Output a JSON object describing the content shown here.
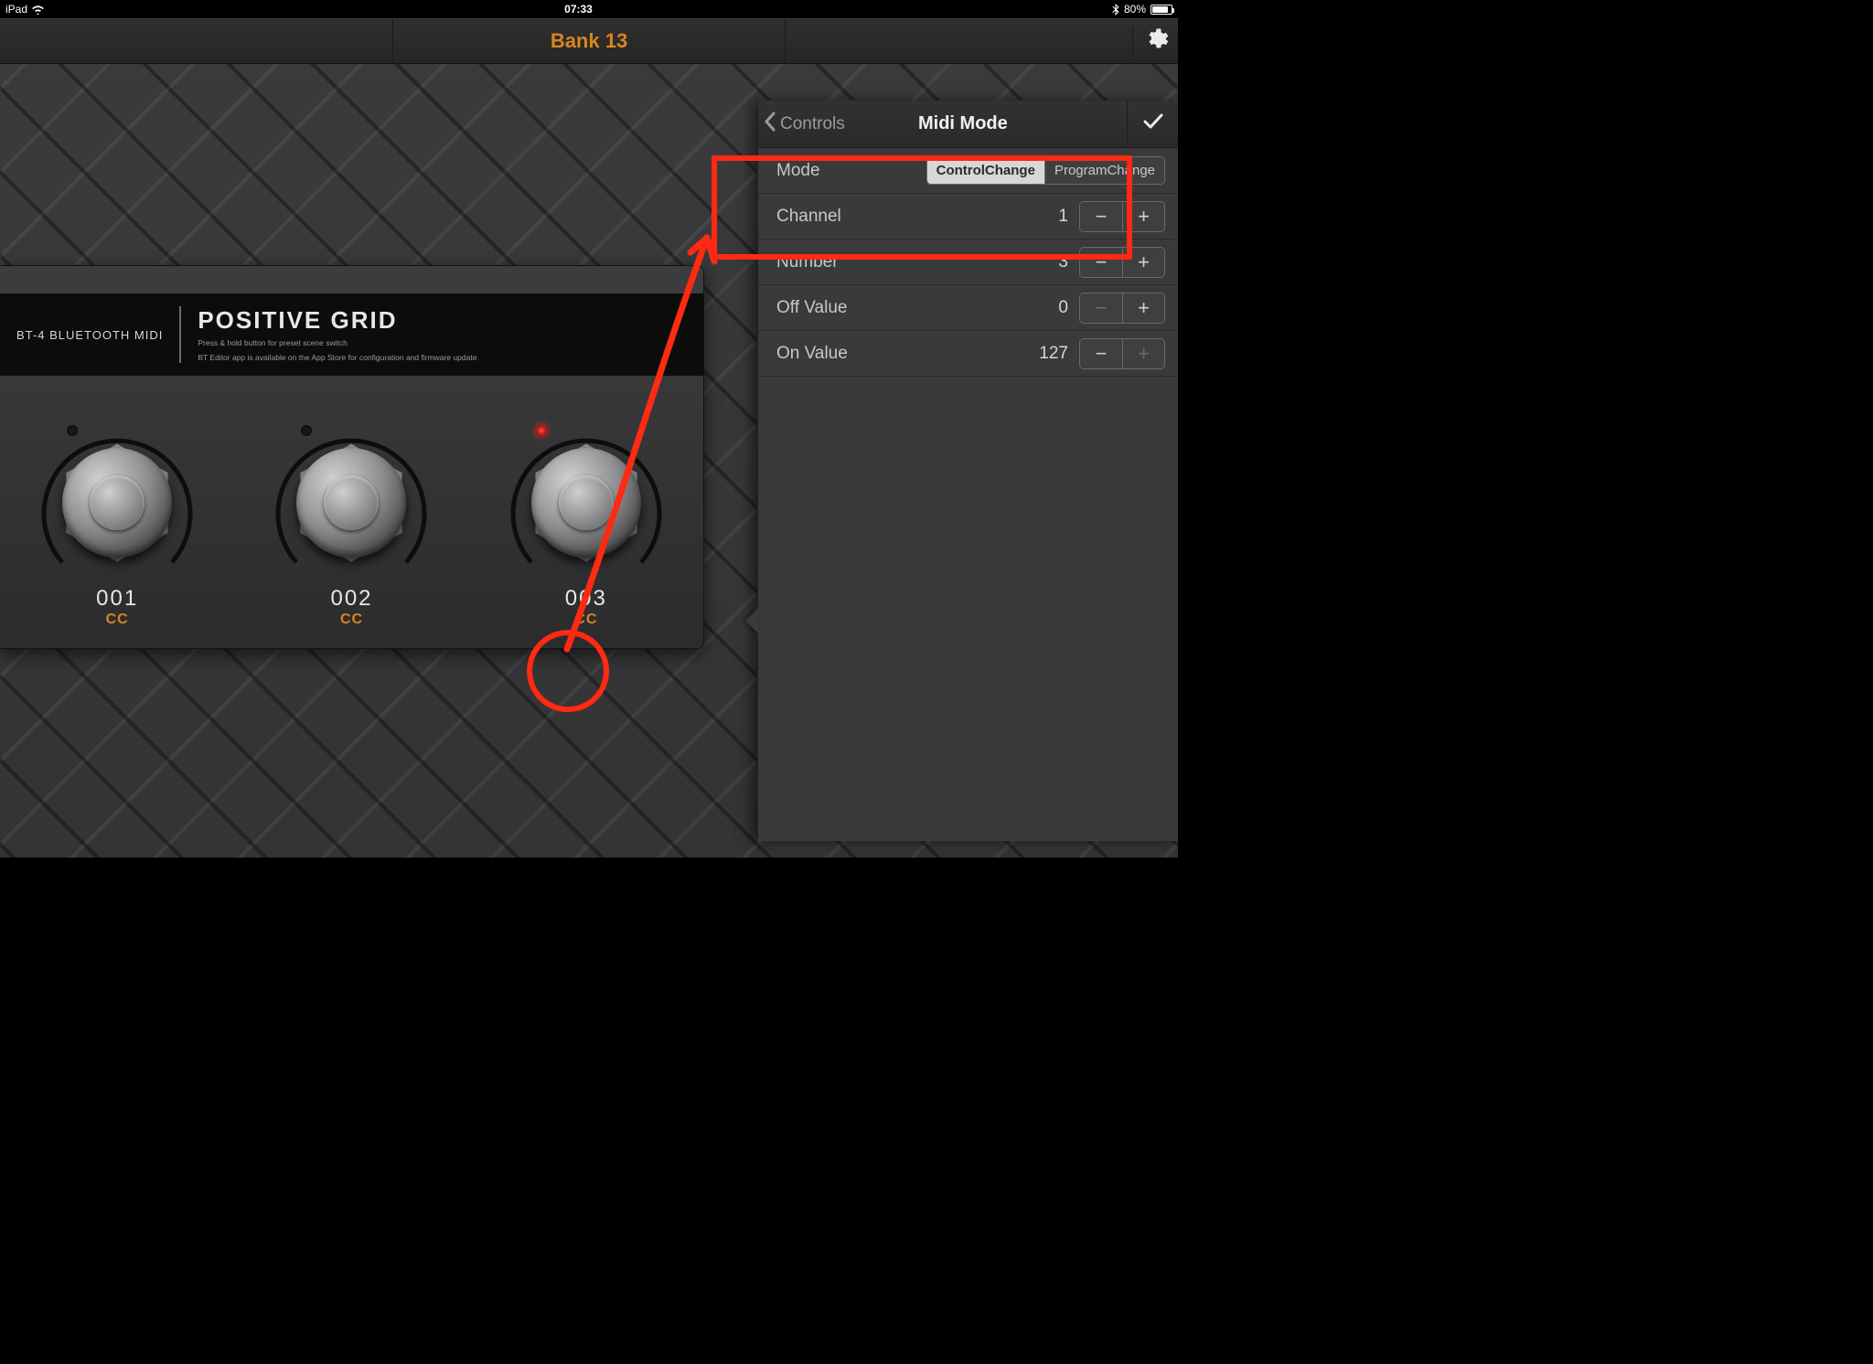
{
  "status_bar": {
    "carrier": "iPad",
    "time": "07:33",
    "battery_pct": "80%"
  },
  "header": {
    "title": "Bank 13"
  },
  "device": {
    "model_label": "BT-4 BLUETOOTH MIDI",
    "brand": "POSITIVE GRID",
    "tagline1": "Press & hold button for preset scene switch",
    "tagline2": "BT Editor app is available on the App Store for configuration and firmware update",
    "knobs": [
      {
        "number": "001",
        "mode": "CC",
        "led_on": false
      },
      {
        "number": "002",
        "mode": "CC",
        "led_on": false
      },
      {
        "number": "003",
        "mode": "CC",
        "led_on": true
      }
    ]
  },
  "panel": {
    "back_label": "Controls",
    "title": "Midi Mode",
    "mode_row": {
      "label": "Mode",
      "options": [
        "ControlChange",
        "ProgramChange"
      ],
      "selected": "ControlChange"
    },
    "rows": [
      {
        "label": "Channel",
        "value": "1",
        "dec_disabled": false,
        "inc_disabled": false
      },
      {
        "label": "Number",
        "value": "3",
        "dec_disabled": false,
        "inc_disabled": false
      },
      {
        "label": "Off Value",
        "value": "0",
        "dec_disabled": true,
        "inc_disabled": false
      },
      {
        "label": "On Value",
        "value": "127",
        "dec_disabled": false,
        "inc_disabled": true
      }
    ]
  },
  "icons": {
    "wifi": "wifi-icon",
    "bluetooth": "bluetooth-icon",
    "battery": "battery-icon",
    "gear": "gear-icon",
    "chevron_left": "chevron-left-icon",
    "check": "check-icon",
    "minus": "minus-icon",
    "plus": "plus-icon"
  }
}
